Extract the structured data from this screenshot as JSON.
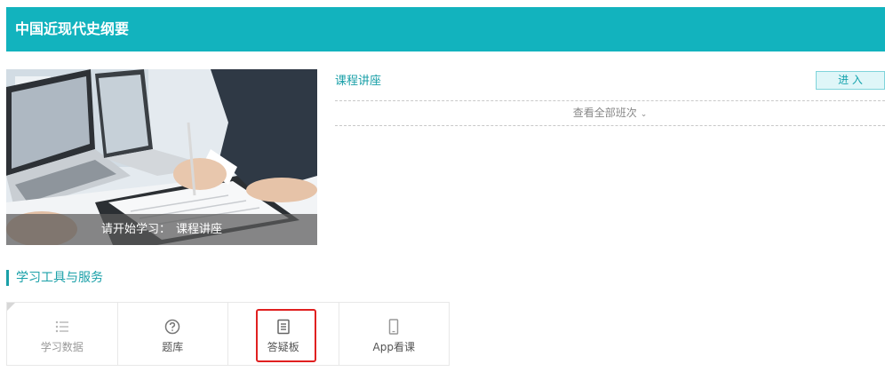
{
  "header": {
    "title": "中国近现代史纲要"
  },
  "banner": {
    "caption_prefix": "请开始学习：",
    "caption_course": "课程讲座"
  },
  "course": {
    "name": "课程讲座",
    "enter_label": "进 入",
    "view_all_label": "查看全部班次"
  },
  "section": {
    "title": "学习工具与服务"
  },
  "tools": [
    {
      "label": "学习数据",
      "icon": "list-icon"
    },
    {
      "label": "题库",
      "icon": "question-circle-icon"
    },
    {
      "label": "答疑板",
      "icon": "document-icon"
    },
    {
      "label": "App看课",
      "icon": "phone-icon"
    }
  ],
  "colors": {
    "accent": "#12b3be",
    "link": "#1aa0a8",
    "highlight": "#e02020"
  }
}
